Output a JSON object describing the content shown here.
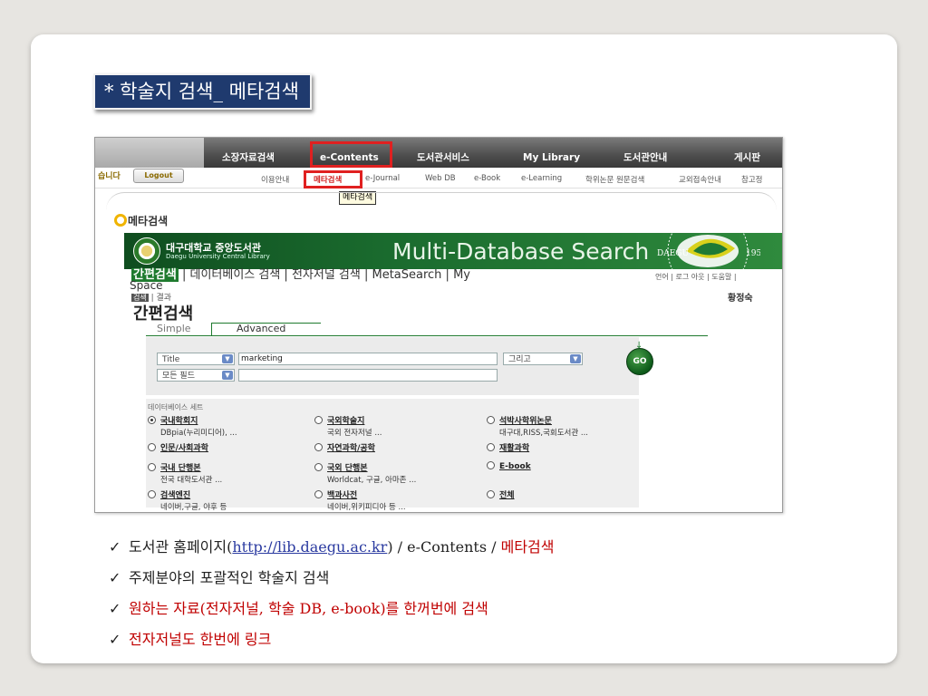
{
  "slide": {
    "title": "* 학술지 검색_ 메타검색"
  },
  "nav": {
    "items": [
      "소장자료검색",
      "e-Contents",
      "도서관서비스",
      "My Library",
      "도서관안내",
      "게시판"
    ],
    "login_name": "습니다",
    "logout": "Logout",
    "subnav": [
      "이용안내",
      "메타검색",
      "e-Journal",
      "Web DB",
      "e-Book",
      "e-Learning",
      "학위논문 원문검색",
      "교외접속안내",
      "참고정"
    ],
    "tooltip": "메타검색"
  },
  "meta": {
    "section_label": "메타검색",
    "uni_kr": "대구대학교 중앙도서관",
    "uni_en": "Daegu University Central Library",
    "banner_title": "Multi-Database Search",
    "emblem_text_left": "DAEGU",
    "emblem_text_right": "1956"
  },
  "tabs": {
    "active": "간편검색",
    "rest": " | 데이터베이스 검색 | 전자저널 검색 | MetaSearch | My",
    "space": "Space",
    "util": "언어 | 로그 아웃 | 도움말 |",
    "crumb_box": "검색",
    "crumb_rest": " | 결과",
    "user": "황정숙",
    "page_heading": "간편검색"
  },
  "modes": {
    "simple": "Simple",
    "advanced": "Advanced"
  },
  "search": {
    "field1": "Title",
    "value1": "marketing",
    "operator": "그리고",
    "field2": "모든 필드",
    "value2": "",
    "go": "GO"
  },
  "db": {
    "title": "데이터베이스 세트",
    "options": [
      {
        "name": "국내학회지",
        "desc": "DBpia(누리미디어), ...",
        "selected": true
      },
      {
        "name": "국외학술지",
        "desc": "국외 전자저널 ...",
        "selected": false
      },
      {
        "name": "석박사학위논문",
        "desc": "대구대,RISS,국회도서관 ...",
        "selected": false
      },
      {
        "name": "인문/사회과학",
        "desc": "",
        "selected": false
      },
      {
        "name": "자연과학/공학",
        "desc": "",
        "selected": false
      },
      {
        "name": "재활과학",
        "desc": "",
        "selected": false
      },
      {
        "name": "국내 단행본",
        "desc": "전국 대학도서관 ...",
        "selected": false
      },
      {
        "name": "국외 단행본",
        "desc": "Worldcat, 구글, 아마존 ...",
        "selected": false
      },
      {
        "name": "E-book",
        "desc": "",
        "selected": false
      },
      {
        "name": "검색엔진",
        "desc": "네이버,구글, 야후 등",
        "selected": false
      },
      {
        "name": "백과사전",
        "desc": "네이버,위키피디아 등 ...",
        "selected": false
      },
      {
        "name": "전체",
        "desc": "",
        "selected": false
      }
    ]
  },
  "bullets": {
    "b1_a": "도서관 홈페이지(",
    "b1_link": "http://lib.daegu.ac.kr",
    "b1_b": ") / e-Contents / ",
    "b1_red": "메타검색",
    "b2": "주제분야의 포괄적인 학술지 검색",
    "b3": "원하는 자료(전자저널, 학술 DB, e-book)를 한꺼번에 검색",
    "b4": "전자저널도 한번에 링크",
    "check": "✓"
  },
  "colors": {
    "title_bg": "#1f3a6e",
    "highlight": "#e02020",
    "banner_green": "#1a6b2e",
    "accent_red": "#c00000"
  }
}
